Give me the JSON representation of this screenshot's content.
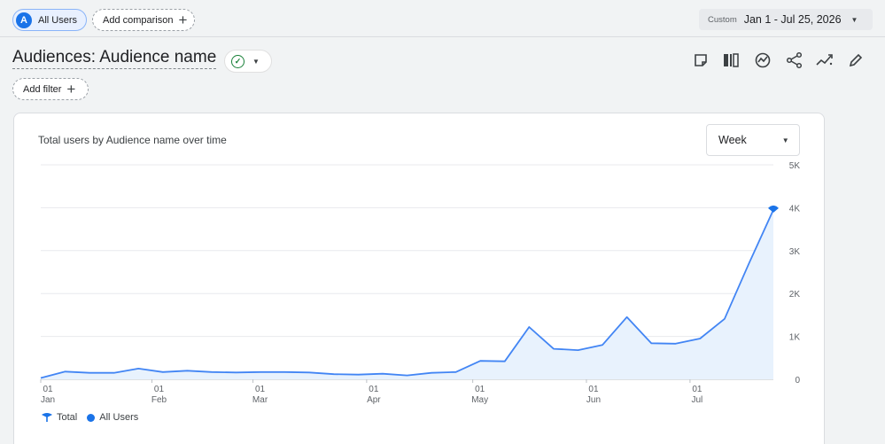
{
  "comparison_bar": {
    "all_users_badge": "A",
    "all_users_label": "All Users",
    "add_comparison_label": "Add comparison"
  },
  "date_range": {
    "prefix": "Custom",
    "value": "Jan 1 - Jul 25, 2026"
  },
  "report": {
    "title": "Audiences: Audience name",
    "add_filter_label": "Add filter",
    "toolbar_icons": [
      "note-icon",
      "compare-icon",
      "insights-icon",
      "share-icon",
      "trend-icon",
      "edit-icon"
    ]
  },
  "card": {
    "title": "Total users by Audience name over time",
    "granularity": "Week"
  },
  "legend": {
    "total_label": "Total",
    "series_label": "All Users"
  },
  "colors": {
    "accent": "#1a73e8",
    "line": "#4285f4",
    "fill": "#e8f2fd",
    "grid": "#e8eaed",
    "success": "#188038"
  },
  "chart_data": {
    "type": "area",
    "title": "Total users by Audience name over time",
    "x_tick_labels": [
      {
        "day": "01",
        "month": "Jan"
      },
      {
        "day": "01",
        "month": "Feb"
      },
      {
        "day": "01",
        "month": "Mar"
      },
      {
        "day": "01",
        "month": "Apr"
      },
      {
        "day": "01",
        "month": "May"
      },
      {
        "day": "01",
        "month": "Jun"
      },
      {
        "day": "01",
        "month": "Jul"
      }
    ],
    "x_tick_weeks": [
      0,
      4.4,
      8.4,
      12.9,
      17.1,
      21.6,
      25.7
    ],
    "y_ticks": [
      0,
      1000,
      2000,
      3000,
      4000,
      5000
    ],
    "y_tick_labels": [
      "0",
      "1K",
      "2K",
      "3K",
      "4K",
      "5K"
    ],
    "ylim": [
      0,
      5000
    ],
    "xlim": [
      0,
      29
    ],
    "grid": true,
    "legend_position": "bottom-left",
    "series": [
      {
        "name": "All Users",
        "values": [
          30,
          180,
          150,
          150,
          250,
          170,
          200,
          170,
          160,
          170,
          170,
          160,
          120,
          110,
          130,
          90,
          150,
          170,
          430,
          420,
          1220,
          710,
          680,
          800,
          1450,
          840,
          830,
          950,
          1410,
          2700,
          3950
        ]
      }
    ]
  }
}
